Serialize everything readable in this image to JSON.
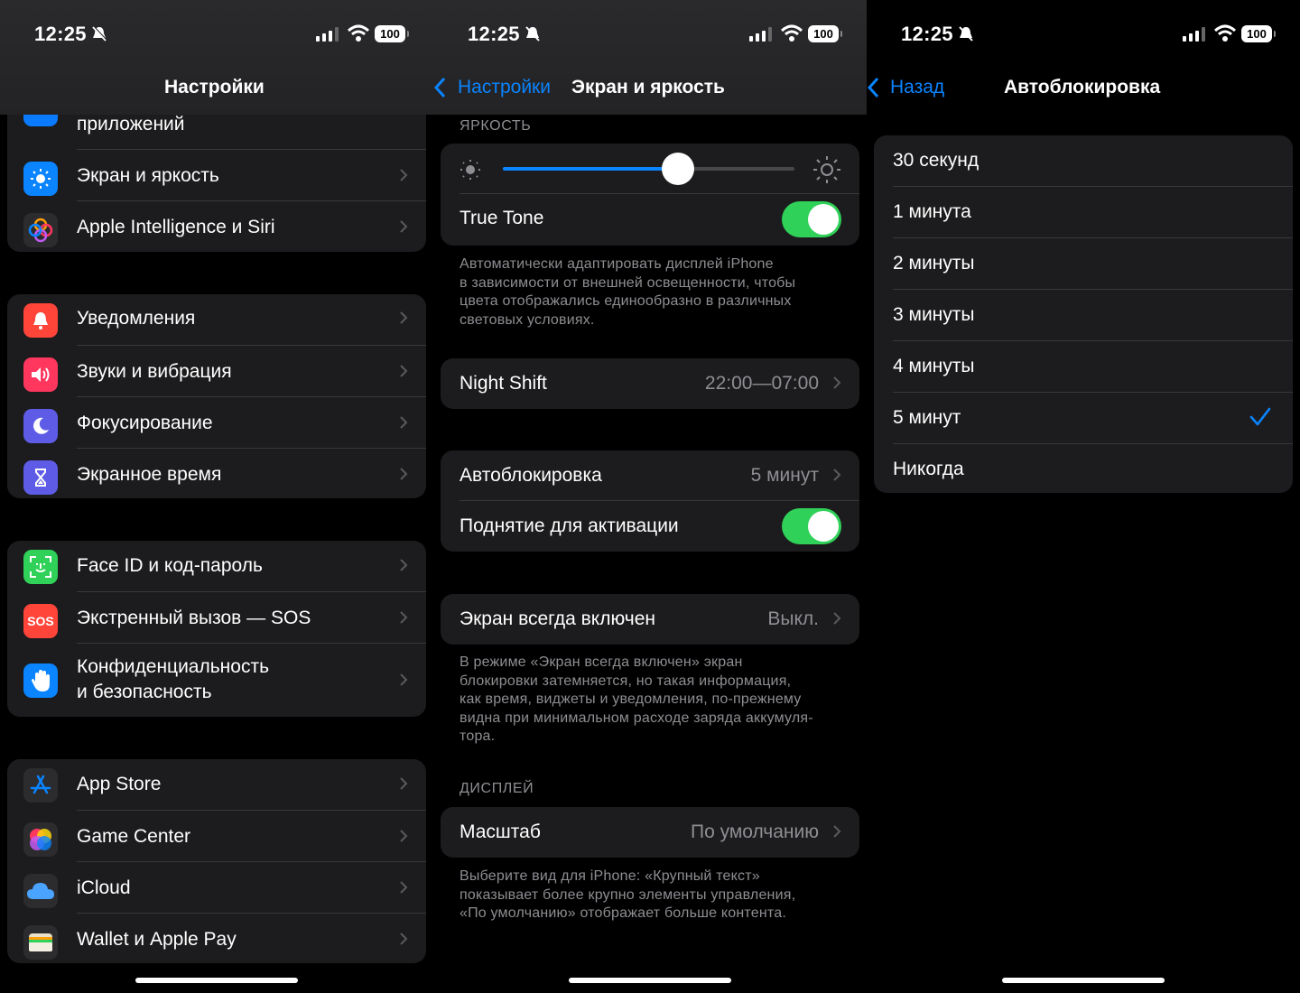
{
  "status": {
    "time": "12:25",
    "battery": "100"
  },
  "panel1": {
    "title": "Настройки",
    "group1": [
      "приложений",
      "Экран и яркость",
      "Apple Intelligence и Siri"
    ],
    "group2": [
      "Уведомления",
      "Звуки и вибрация",
      "Фокусирование",
      "Экранное время"
    ],
    "group3": [
      "Face ID и код-пароль",
      "Экстренный вызов — SOS",
      "Конфиденциальность",
      "и безопасность"
    ],
    "group4": [
      "App Store",
      "Game Center",
      "iCloud",
      "Wallet и Apple Pay"
    ],
    "sos_icon_text": "SOS"
  },
  "panel2": {
    "back": "Настройки",
    "title": "Экран и яркость",
    "brightness_header": "ЯРКОСТЬ",
    "brightness_level": 0.6,
    "true_tone": "True Tone",
    "true_tone_note": [
      "Автоматически адаптировать дисплей iPhone",
      "в зависимости от внешней освещенности, чтобы",
      "цвета отображались единообразно в различных",
      "световых условиях."
    ],
    "night_shift": "Night Shift",
    "night_shift_value": "22:00—07:00",
    "autolock": "Автоблокировка",
    "autolock_value": "5 минут",
    "raise_to_wake": "Поднятие для активации",
    "always_on": "Экран всегда включен",
    "always_on_value": "Выкл.",
    "always_on_note": [
      "В режиме «Экран всегда включен» экран",
      "блокировки затемняется, но такая информация,",
      "как время, виджеты и уведомления, по-прежнему",
      "видна при минимальном расходе заряда аккумуля-",
      "тора."
    ],
    "display_header": "ДИСПЛЕЙ",
    "zoom": "Масштаб",
    "zoom_value": "По умолчанию",
    "zoom_note": [
      "Выберите вид для iPhone: «Крупный текст»",
      "показывает более крупно элементы управления,",
      "«По умолчанию» отображает больше контента."
    ]
  },
  "panel3": {
    "back": "Назад",
    "title": "Автоблокировка",
    "options": [
      "30 секунд",
      "1 минута",
      "2 минуты",
      "3 минуты",
      "4 минуты",
      "5 минут",
      "Никогда"
    ],
    "selected_index": 5
  }
}
